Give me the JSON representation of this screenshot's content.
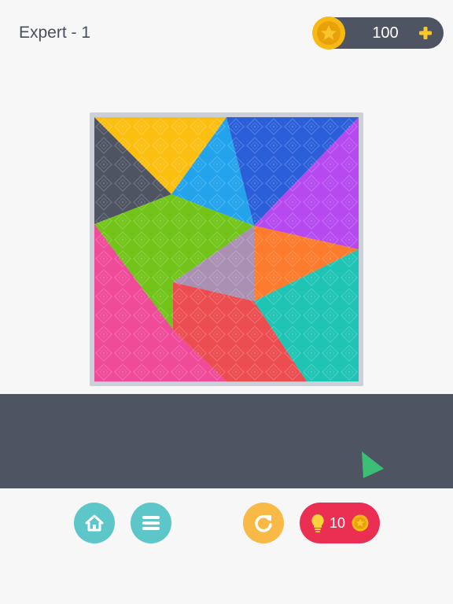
{
  "header": {
    "level_title": "Expert - 1",
    "coins": "100",
    "coin_icon": "star-coin-icon",
    "add_icon": "plus-icon"
  },
  "board": {
    "pieces": [
      {
        "name": "dark-gray",
        "color": "#4e5462"
      },
      {
        "name": "yellow",
        "color": "#fbbf11"
      },
      {
        "name": "light-blue",
        "color": "#22a3ec"
      },
      {
        "name": "blue",
        "color": "#2b5fd9"
      },
      {
        "name": "purple",
        "color": "#b64af0"
      },
      {
        "name": "green",
        "color": "#72c41a"
      },
      {
        "name": "orange",
        "color": "#fc7b2c"
      },
      {
        "name": "mauve",
        "color": "#aa90b3"
      },
      {
        "name": "pink",
        "color": "#ef4b99"
      },
      {
        "name": "red",
        "color": "#ec4d50"
      },
      {
        "name": "teal",
        "color": "#1fc4b4"
      }
    ]
  },
  "tray": {
    "remaining_piece_color": "#3cbf74"
  },
  "toolbar": {
    "home_icon": "home-icon",
    "menu_icon": "menu-icon",
    "restart_icon": "restart-icon",
    "hint_icon": "lightbulb-icon",
    "hint_cost": "10"
  },
  "colors": {
    "background": "#f7f7f7",
    "dark": "#4e5462",
    "accent_teal": "#5cc6c9",
    "accent_orange": "#f8b946",
    "accent_red": "#ea2f52",
    "coin_gold": "#f6b617"
  }
}
